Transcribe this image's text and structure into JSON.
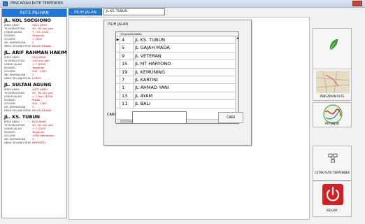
{
  "window": {
    "title": "PENCARIAN RUTE TERPENDEK"
  },
  "sidebar": {
    "header": "RUTE PILIHAN",
    "roads": [
      {
        "name": "JL. KOL SOEGIONO",
        "rows": [
          [
            "JENIS ARAH",
            "SATU ARAH"
          ],
          [
            "TK KEMACETAN",
            "40 - 60 km/ jam"
          ],
          [
            "LEBAR JALAN",
            "7 - 10     (1000"
          ],
          [
            "KONDISI",
            "Tergenan"
          ],
          [
            "VOLUME",
            "> 1000"
          ],
          [
            "JML SIMPANGAN",
            "2"
          ],
          [
            "ARAH SELANJUTNYA",
            "BELOK KANAN"
          ]
        ]
      },
      {
        "name": "JL. ARIF RAHMAN HAKIM",
        "rows": [
          [
            "JENIS ARAH",
            "DUA ARAH"
          ],
          [
            "TK KEMACETAN",
            "<40 km/ jam"
          ],
          [
            "LEBAR JALAN",
            "< 7          (1000"
          ],
          [
            "KONDISI",
            "Tergenan"
          ],
          [
            "VOLUME",
            "500 - 1000"
          ],
          [
            "JML SIMPANGAN",
            "3"
          ],
          [
            "ARAH SELANJUTNYA",
            "LURUS"
          ]
        ]
      },
      {
        "name": "JL. SULTAN AGUNG",
        "rows": [
          [
            "JENIS ARAH",
            "SATU ARAH"
          ],
          [
            "TK KEMACETAN",
            "40 - 60 km/ jam"
          ],
          [
            "LEBAR JALAN",
            "> 7 (km) (1000"
          ],
          [
            "KONDISI",
            "Rusak"
          ],
          [
            "VOLUME",
            "500 - 1000"
          ],
          [
            "JML SIMPANGAN",
            "3"
          ],
          [
            "ARAH SELANJUTNYA",
            "BELOK KANAN"
          ]
        ]
      },
      {
        "name": "JL. KS. TUBUN",
        "rows": [
          [
            "JENIS ARAH",
            "DUA ARAH"
          ],
          [
            "TK KEMACETAN",
            "40 - 60 km/ jam"
          ],
          [
            "LEBAR JALAN",
            "< 7          (7000"
          ],
          [
            "KONDISI",
            "Tergenan"
          ],
          [
            "VOLUME",
            "<500 kendaraan"
          ],
          [
            "JML SIMPANGAN",
            "3"
          ],
          [
            "ARAH SELANJUTNYA",
            "BERHENTI"
          ]
        ]
      }
    ]
  },
  "tab": {
    "label": "PILIH JALAN"
  },
  "search": {
    "value": "JL KS. TUBUN"
  },
  "dialog": {
    "title": "PILIH JALAN",
    "columns": [
      "KD JALAN",
      "NAMA"
    ],
    "rows": [
      {
        "marker": "▶",
        "kd": "4",
        "name": "JL KS. TUBUN"
      },
      {
        "marker": "",
        "kd": "5",
        "name": "JL GAJAH MADA"
      },
      {
        "marker": "",
        "kd": "9",
        "name": "JL VETERAN"
      },
      {
        "marker": "",
        "kd": "15",
        "name": "JL MT HARYONO"
      },
      {
        "marker": "",
        "kd": "19",
        "name": "JL KEMUNING"
      },
      {
        "marker": "",
        "kd": "7",
        "name": "JL KARTINI"
      },
      {
        "marker": "",
        "kd": "1",
        "name": "JL AHMAD YANI"
      },
      {
        "marker": "",
        "kd": "13",
        "name": "JL AYAM"
      },
      {
        "marker": "",
        "kd": "11",
        "name": "JL BALI"
      }
    ],
    "cari_label": "CARI",
    "cari_value": "",
    "cari_button": "CARI"
  },
  "right_buttons": [
    {
      "name": "pencarian-jalan",
      "label": "PENCARIAN JALAN",
      "icon": "leaf-icon",
      "color": "#3aa32e"
    },
    {
      "name": "pencarian-rute",
      "label": "PENCARIAN RUTE",
      "icon": "map-thumbnail-icon",
      "color": "#c8b89a"
    },
    {
      "name": "petunjuk",
      "label": "PETUNJUK",
      "icon": "globe-route-icon",
      "color": "#5aa83c"
    },
    {
      "name": "cetak-rute",
      "label": "CETAK RUTE TERPENDEK",
      "icon": "network-icon",
      "color": "#444444"
    },
    {
      "name": "keluar",
      "label": "KELUAR",
      "icon": "power-icon",
      "color": "#d42020"
    }
  ],
  "colors": {
    "accent": "#1f77d8",
    "value_text": "#cc0000"
  }
}
